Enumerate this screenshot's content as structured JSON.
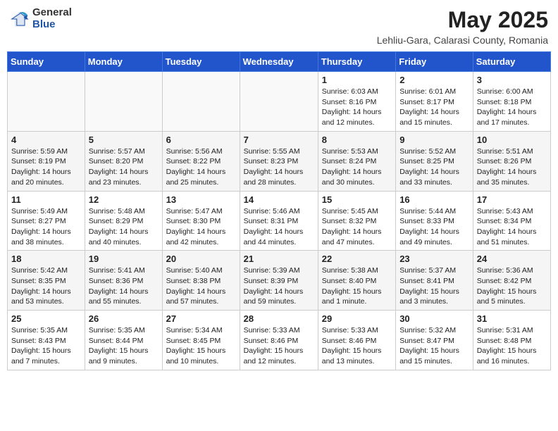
{
  "header": {
    "logo_general": "General",
    "logo_blue": "Blue",
    "month_title": "May 2025",
    "subtitle": "Lehliu-Gara, Calarasi County, Romania"
  },
  "weekdays": [
    "Sunday",
    "Monday",
    "Tuesday",
    "Wednesday",
    "Thursday",
    "Friday",
    "Saturday"
  ],
  "weeks": [
    [
      {
        "day": "",
        "info": ""
      },
      {
        "day": "",
        "info": ""
      },
      {
        "day": "",
        "info": ""
      },
      {
        "day": "",
        "info": ""
      },
      {
        "day": "1",
        "info": "Sunrise: 6:03 AM\nSunset: 8:16 PM\nDaylight: 14 hours\nand 12 minutes."
      },
      {
        "day": "2",
        "info": "Sunrise: 6:01 AM\nSunset: 8:17 PM\nDaylight: 14 hours\nand 15 minutes."
      },
      {
        "day": "3",
        "info": "Sunrise: 6:00 AM\nSunset: 8:18 PM\nDaylight: 14 hours\nand 17 minutes."
      }
    ],
    [
      {
        "day": "4",
        "info": "Sunrise: 5:59 AM\nSunset: 8:19 PM\nDaylight: 14 hours\nand 20 minutes."
      },
      {
        "day": "5",
        "info": "Sunrise: 5:57 AM\nSunset: 8:20 PM\nDaylight: 14 hours\nand 23 minutes."
      },
      {
        "day": "6",
        "info": "Sunrise: 5:56 AM\nSunset: 8:22 PM\nDaylight: 14 hours\nand 25 minutes."
      },
      {
        "day": "7",
        "info": "Sunrise: 5:55 AM\nSunset: 8:23 PM\nDaylight: 14 hours\nand 28 minutes."
      },
      {
        "day": "8",
        "info": "Sunrise: 5:53 AM\nSunset: 8:24 PM\nDaylight: 14 hours\nand 30 minutes."
      },
      {
        "day": "9",
        "info": "Sunrise: 5:52 AM\nSunset: 8:25 PM\nDaylight: 14 hours\nand 33 minutes."
      },
      {
        "day": "10",
        "info": "Sunrise: 5:51 AM\nSunset: 8:26 PM\nDaylight: 14 hours\nand 35 minutes."
      }
    ],
    [
      {
        "day": "11",
        "info": "Sunrise: 5:49 AM\nSunset: 8:27 PM\nDaylight: 14 hours\nand 38 minutes."
      },
      {
        "day": "12",
        "info": "Sunrise: 5:48 AM\nSunset: 8:29 PM\nDaylight: 14 hours\nand 40 minutes."
      },
      {
        "day": "13",
        "info": "Sunrise: 5:47 AM\nSunset: 8:30 PM\nDaylight: 14 hours\nand 42 minutes."
      },
      {
        "day": "14",
        "info": "Sunrise: 5:46 AM\nSunset: 8:31 PM\nDaylight: 14 hours\nand 44 minutes."
      },
      {
        "day": "15",
        "info": "Sunrise: 5:45 AM\nSunset: 8:32 PM\nDaylight: 14 hours\nand 47 minutes."
      },
      {
        "day": "16",
        "info": "Sunrise: 5:44 AM\nSunset: 8:33 PM\nDaylight: 14 hours\nand 49 minutes."
      },
      {
        "day": "17",
        "info": "Sunrise: 5:43 AM\nSunset: 8:34 PM\nDaylight: 14 hours\nand 51 minutes."
      }
    ],
    [
      {
        "day": "18",
        "info": "Sunrise: 5:42 AM\nSunset: 8:35 PM\nDaylight: 14 hours\nand 53 minutes."
      },
      {
        "day": "19",
        "info": "Sunrise: 5:41 AM\nSunset: 8:36 PM\nDaylight: 14 hours\nand 55 minutes."
      },
      {
        "day": "20",
        "info": "Sunrise: 5:40 AM\nSunset: 8:38 PM\nDaylight: 14 hours\nand 57 minutes."
      },
      {
        "day": "21",
        "info": "Sunrise: 5:39 AM\nSunset: 8:39 PM\nDaylight: 14 hours\nand 59 minutes."
      },
      {
        "day": "22",
        "info": "Sunrise: 5:38 AM\nSunset: 8:40 PM\nDaylight: 15 hours\nand 1 minute."
      },
      {
        "day": "23",
        "info": "Sunrise: 5:37 AM\nSunset: 8:41 PM\nDaylight: 15 hours\nand 3 minutes."
      },
      {
        "day": "24",
        "info": "Sunrise: 5:36 AM\nSunset: 8:42 PM\nDaylight: 15 hours\nand 5 minutes."
      }
    ],
    [
      {
        "day": "25",
        "info": "Sunrise: 5:35 AM\nSunset: 8:43 PM\nDaylight: 15 hours\nand 7 minutes."
      },
      {
        "day": "26",
        "info": "Sunrise: 5:35 AM\nSunset: 8:44 PM\nDaylight: 15 hours\nand 9 minutes."
      },
      {
        "day": "27",
        "info": "Sunrise: 5:34 AM\nSunset: 8:45 PM\nDaylight: 15 hours\nand 10 minutes."
      },
      {
        "day": "28",
        "info": "Sunrise: 5:33 AM\nSunset: 8:46 PM\nDaylight: 15 hours\nand 12 minutes."
      },
      {
        "day": "29",
        "info": "Sunrise: 5:33 AM\nSunset: 8:46 PM\nDaylight: 15 hours\nand 13 minutes."
      },
      {
        "day": "30",
        "info": "Sunrise: 5:32 AM\nSunset: 8:47 PM\nDaylight: 15 hours\nand 15 minutes."
      },
      {
        "day": "31",
        "info": "Sunrise: 5:31 AM\nSunset: 8:48 PM\nDaylight: 15 hours\nand 16 minutes."
      }
    ]
  ]
}
